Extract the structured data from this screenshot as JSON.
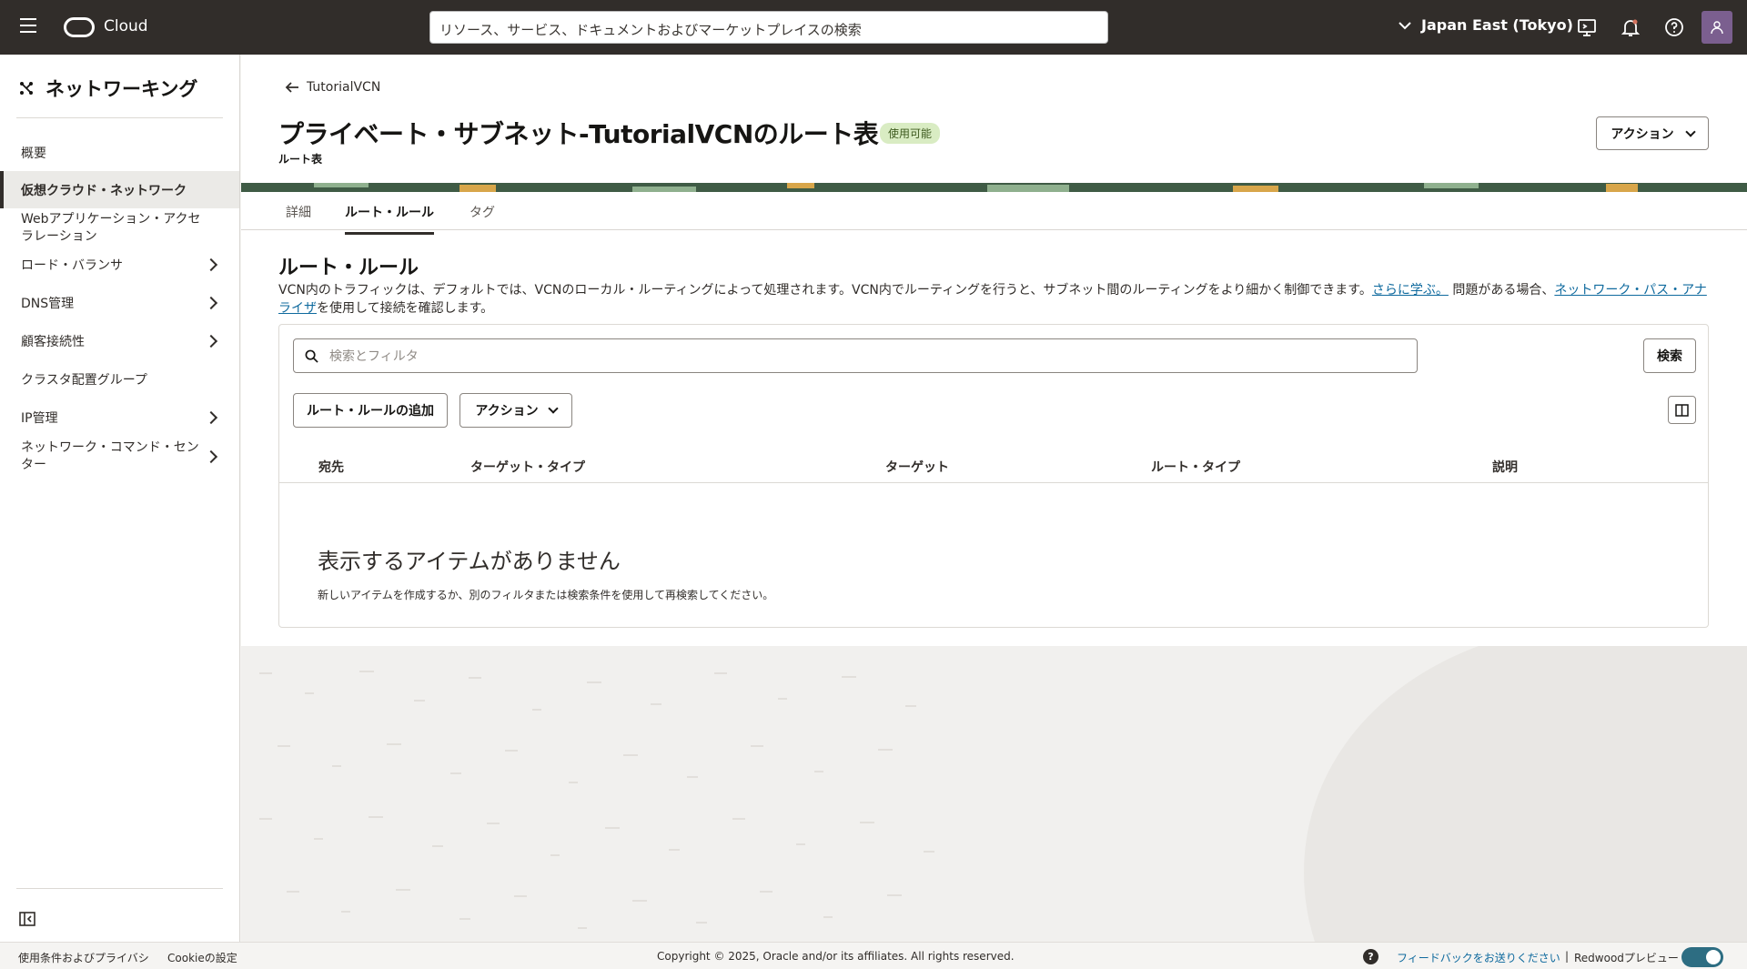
{
  "header": {
    "brand": "Cloud",
    "search_placeholder": "リソース、サービス、ドキュメントおよびマーケットプレイスの検索",
    "region": "Japan East (Tokyo)"
  },
  "sidebar": {
    "title": "ネットワーキング",
    "items": [
      {
        "label": "概要"
      },
      {
        "label": "仮想クラウド・ネットワーク"
      },
      {
        "label": "Webアプリケーション・アクセラレーション"
      },
      {
        "label": "ロード・バランサ"
      },
      {
        "label": "DNS管理"
      },
      {
        "label": "顧客接続性"
      },
      {
        "label": "クラスタ配置グループ"
      },
      {
        "label": "IP管理"
      },
      {
        "label": "ネットワーク・コマンド・センター"
      }
    ]
  },
  "breadcrumb": {
    "back_label": "TutorialVCN"
  },
  "page": {
    "title": "プライベート・サブネット-TutorialVCNのルート表",
    "status": "使用可能",
    "subtitle": "ルート表",
    "actions_label": "アクション"
  },
  "tabs": [
    {
      "label": "詳細"
    },
    {
      "label": "ルート・ルール"
    },
    {
      "label": "タグ"
    }
  ],
  "section": {
    "title": "ルート・ルール",
    "desc_part1": "VCN内のトラフィックは、デフォルトでは、VCNのローカル・ルーティングによって処理されます。VCN内でルーティングを行うと、サブネット間のルーティングをより細かく制御できます。",
    "learn_more": "さらに学ぶ。",
    "desc_part2": " 問題がある場合、",
    "path_analyzer": "ネットワーク・パス・アナライザ",
    "desc_part3": "を使用して接続を確認します。"
  },
  "table": {
    "filter_placeholder": "検索とフィルタ",
    "search_label": "検索",
    "add_label": "ルート・ルールの追加",
    "actions_label": "アクション",
    "columns": [
      "宛先",
      "ターゲット・タイプ",
      "ターゲット",
      "ルート・タイプ",
      "説明"
    ],
    "empty_title": "表示するアイテムがありません",
    "empty_sub": "新しいアイテムを作成するか、別のフィルタまたは検索条件を使用して再検索してください。"
  },
  "footer": {
    "terms": "使用条件およびプライバシ",
    "cookies": "Cookieの設定",
    "copyright": "Copyright © 2025, Oracle and/or its affiliates. All rights reserved.",
    "feedback": "フィードバックをお送りください",
    "separator": "|",
    "preview": "Redwoodプレビュー"
  },
  "colors": {
    "header_bg": "#312d2a",
    "badge_bg": "#d9ecc3",
    "link": "#0f6a9e",
    "toggle": "#2d6d82"
  }
}
